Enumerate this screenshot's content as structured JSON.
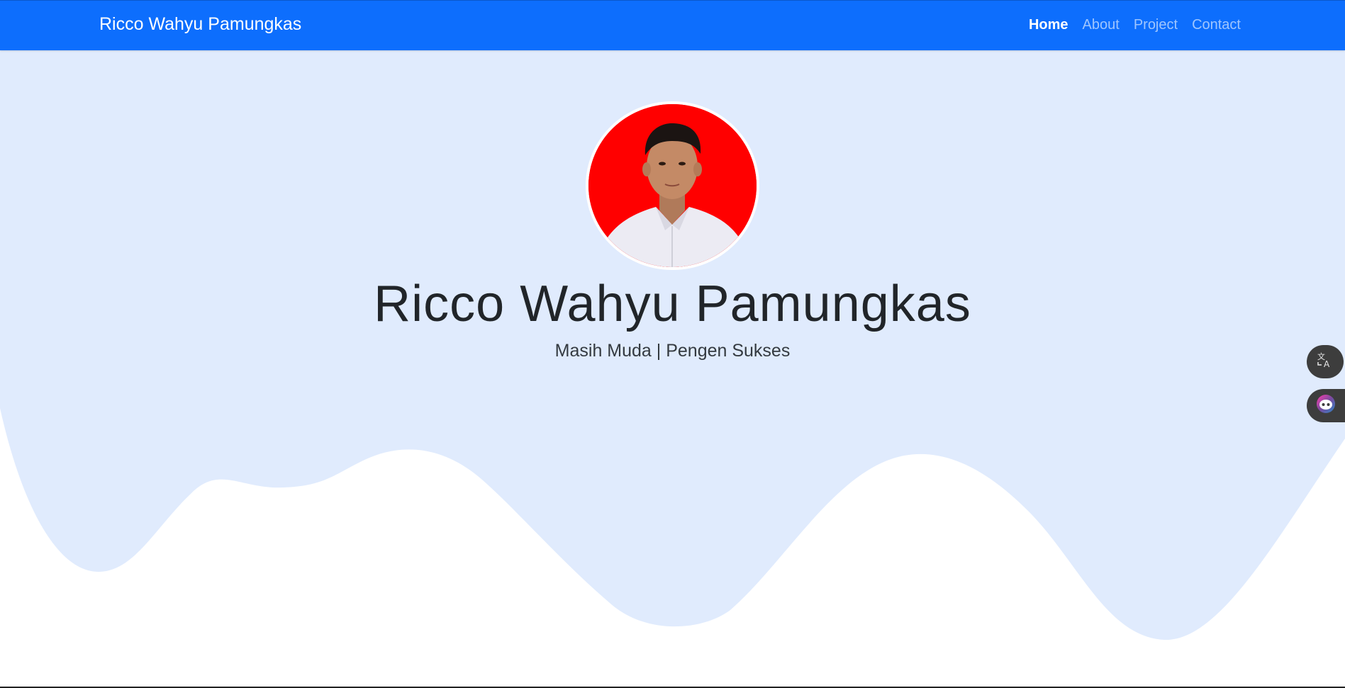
{
  "navbar": {
    "brand": "Ricco Wahyu Pamungkas",
    "links": [
      {
        "label": "Home",
        "active": true
      },
      {
        "label": "About",
        "active": false
      },
      {
        "label": "Project",
        "active": false
      },
      {
        "label": "Contact",
        "active": false
      }
    ],
    "color": "#0d6efd"
  },
  "hero": {
    "title": "Ricco Wahyu Pamungkas",
    "subtitle": "Masih Muda | Pengen Sukses",
    "background_color": "#e0ebfd",
    "avatar_background": "#ff0000"
  },
  "floating_buttons": [
    {
      "icon": "translate-icon"
    },
    {
      "icon": "assistant-bot-icon"
    }
  ]
}
